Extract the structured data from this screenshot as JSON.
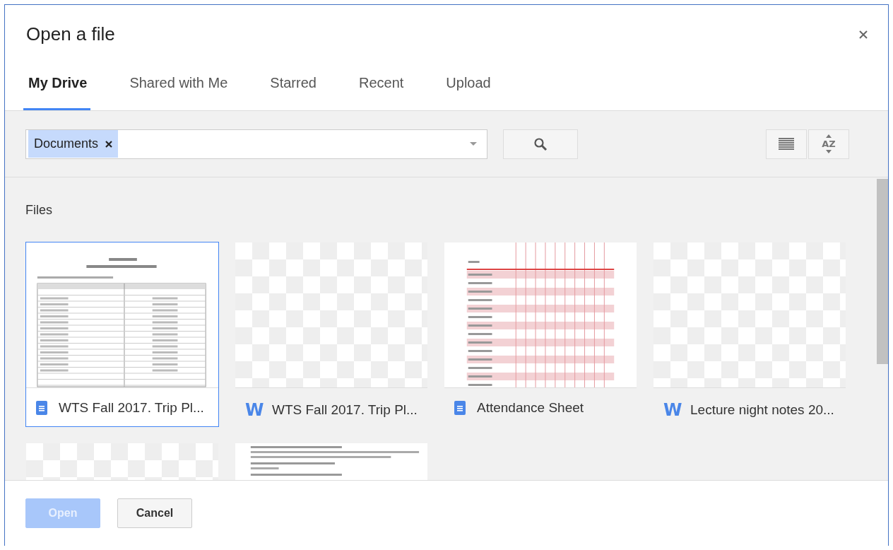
{
  "dialog": {
    "title": "Open a file"
  },
  "tabs": [
    {
      "label": "My Drive",
      "selected": true
    },
    {
      "label": "Shared with Me",
      "selected": false
    },
    {
      "label": "Starred",
      "selected": false
    },
    {
      "label": "Recent",
      "selected": false
    },
    {
      "label": "Upload",
      "selected": false
    }
  ],
  "toolbar": {
    "filter_chip": "Documents",
    "sort_letters": "AZ"
  },
  "section_title": "Files",
  "files": [
    {
      "name": "WTS Fall 2017. Trip Pl...",
      "kind": "docs",
      "preview": {
        "kind": "table"
      },
      "selected": true
    },
    {
      "name": "WTS Fall 2017. Trip Pl...",
      "kind": "word",
      "icon_letter": "W",
      "preview": {
        "kind": "blank"
      },
      "selected": false
    },
    {
      "name": "Attendance Sheet",
      "kind": "docs",
      "preview": {
        "kind": "sheet"
      },
      "selected": false
    },
    {
      "name": "Lecture night notes 20...",
      "kind": "word",
      "icon_letter": "W",
      "preview": {
        "kind": "blank"
      },
      "selected": false
    },
    {
      "preview": {
        "kind": "blank"
      },
      "selected": false
    },
    {
      "preview": {
        "kind": "text"
      },
      "selected": false
    }
  ],
  "buttons": [
    {
      "label": "Open",
      "kind": "primary",
      "disabled": true
    },
    {
      "label": "Cancel",
      "kind": "secondary",
      "disabled": false
    }
  ]
}
